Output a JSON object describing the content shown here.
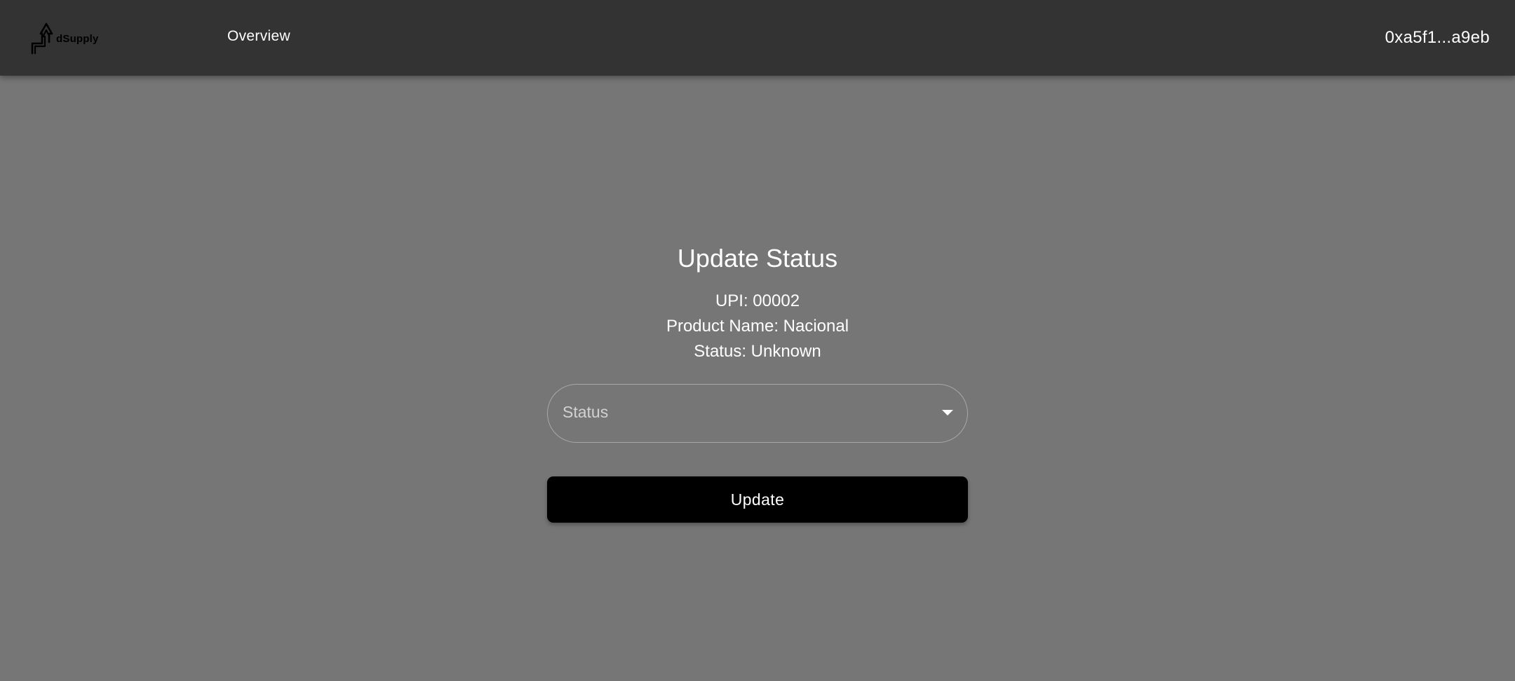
{
  "header": {
    "logo_text": "dSupply",
    "nav_overview": "Overview",
    "account_address": "0xa5f1...a9eb"
  },
  "form": {
    "title": "Update Status",
    "upi_line": "UPI: 00002",
    "product_line": "Product Name: Nacional",
    "status_line": "Status: Unknown",
    "status_select_placeholder": "Status",
    "update_button_label": "Update"
  },
  "colors": {
    "topbar_bg": "#333333",
    "page_bg": "#767676",
    "button_bg": "#000000",
    "text": "#ffffff"
  }
}
